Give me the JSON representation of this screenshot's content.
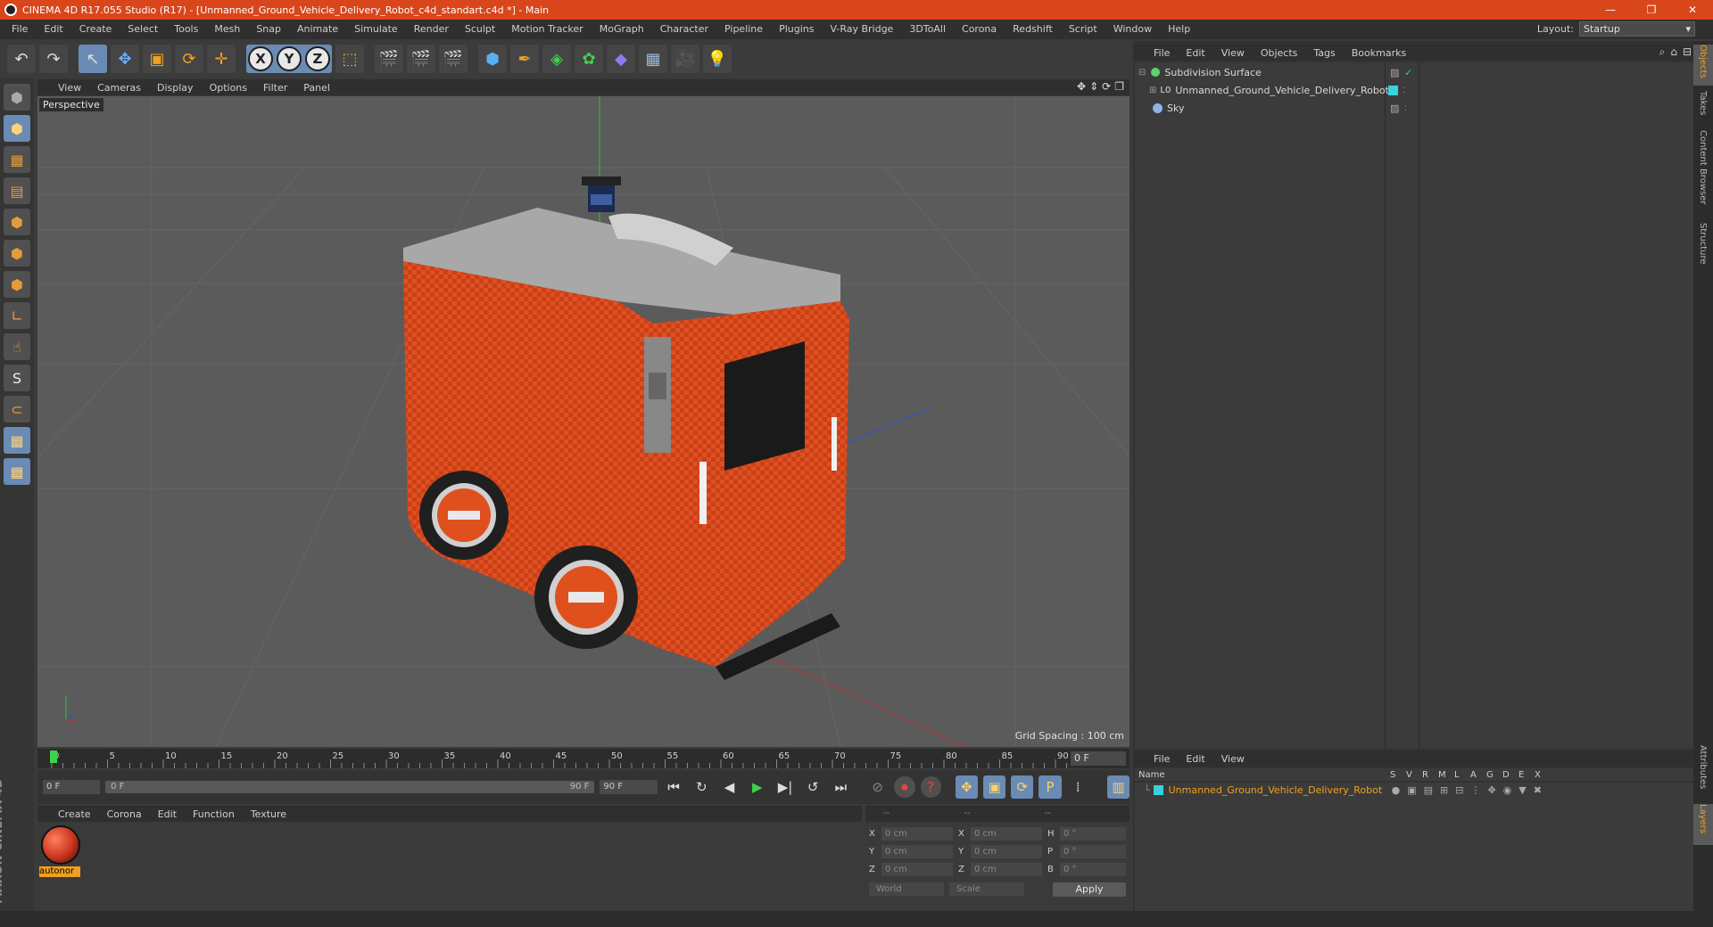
{
  "titlebar": {
    "title": "CINEMA 4D R17.055 Studio (R17) - [Unmanned_Ground_Vehicle_Delivery_Robot_c4d_standart.c4d *] - Main",
    "minimize": "—",
    "restore": "❐",
    "close": "✕"
  },
  "menu": [
    "File",
    "Edit",
    "Create",
    "Select",
    "Tools",
    "Mesh",
    "Snap",
    "Animate",
    "Simulate",
    "Render",
    "Sculpt",
    "Motion Tracker",
    "MoGraph",
    "Character",
    "Pipeline",
    "Plugins",
    "V-Ray Bridge",
    "3DToAll",
    "Corona",
    "Redshift",
    "Script",
    "Window",
    "Help"
  ],
  "layout": {
    "label": "Layout:",
    "value": "Startup"
  },
  "toolbar": {
    "undo": "↶",
    "redo": "↷",
    "select": "↖",
    "move": "✥",
    "scale": "▣",
    "rotate": "⟳",
    "transform": "✛",
    "axis_x": "X",
    "axis_y": "Y",
    "axis_z": "Z",
    "coord": "⬚",
    "render_view": "🎬",
    "render_pic": "🎬",
    "render_settings": "🎬",
    "cube": "⬢",
    "pen": "✒",
    "subdiv": "◈",
    "array": "✿",
    "deformer": "◆",
    "floor": "▦",
    "camera": "🎥",
    "light": "💡"
  },
  "left_tools": [
    "⬢",
    "▦",
    "▤",
    "⬢",
    "⬢",
    "⬢",
    "∟",
    "☝",
    "S",
    "⊂",
    "▦",
    "▦"
  ],
  "viewport": {
    "menu": [
      "View",
      "Cameras",
      "Display",
      "Options",
      "Filter",
      "Panel"
    ],
    "label": "Perspective",
    "grid_spacing": "Grid Spacing : 100 cm",
    "nav_icons": [
      "✥",
      "⇕",
      "⟳",
      "❐"
    ]
  },
  "timeline": {
    "ticks": [
      "0",
      "5",
      "10",
      "15",
      "20",
      "25",
      "30",
      "35",
      "40",
      "45",
      "50",
      "55",
      "60",
      "65",
      "70",
      "75",
      "80",
      "85",
      "90"
    ],
    "current_frame": "0 F",
    "start": "0 F",
    "slider_left": "0 F",
    "slider_right": "90 F",
    "end": "90 F"
  },
  "transport": {
    "first": "⏮",
    "prev_key": "↻",
    "prev": "◀",
    "play": "▶",
    "next": "▶|",
    "next_key": "↺",
    "last": "⏭",
    "key_off": "⊘",
    "record": "⏺",
    "help": "?",
    "move_key": "✥",
    "scale_key": "▣",
    "rot_key": "⟳",
    "param_key": "P",
    "grid": "⁞",
    "timeline": "▥"
  },
  "materials": {
    "menu": [
      "Create",
      "Corona",
      "Edit",
      "Function",
      "Texture"
    ],
    "items": [
      {
        "name": "autonor"
      }
    ]
  },
  "coordinates": {
    "head": [
      "--",
      "--",
      "--"
    ],
    "rows": [
      {
        "a": "X",
        "av": "0 cm",
        "b": "X",
        "bv": "0 cm",
        "c": "H",
        "cv": "0 °"
      },
      {
        "a": "Y",
        "av": "0 cm",
        "b": "Y",
        "bv": "0 cm",
        "c": "P",
        "cv": "0 °"
      },
      {
        "a": "Z",
        "av": "0 cm",
        "b": "Z",
        "bv": "0 cm",
        "c": "B",
        "cv": "0 °"
      }
    ],
    "mode": "World",
    "scale": "Scale",
    "apply": "Apply"
  },
  "object_manager": {
    "menu": [
      "File",
      "Edit",
      "View",
      "Objects",
      "Tags",
      "Bookmarks"
    ],
    "objects": [
      {
        "name": "Subdivision Surface",
        "icon_color": "#5fd36e",
        "indent": 0
      },
      {
        "name": "Unmanned_Ground_Vehicle_Delivery_Robot",
        "icon_color": "#cfcfcf",
        "indent": 1,
        "tag": "#3ad1d9"
      },
      {
        "name": "Sky",
        "icon_color": "#8bb5e8",
        "indent": 0
      }
    ]
  },
  "side_tabs": [
    "Objects",
    "Takes",
    "Content Browser",
    "Structure",
    "Attributes",
    "Layers"
  ],
  "layer_manager": {
    "menu": [
      "File",
      "Edit",
      "View"
    ],
    "columns": [
      "Name",
      "S",
      "V",
      "R",
      "M",
      "L",
      "A",
      "G",
      "D",
      "E",
      "X"
    ],
    "layers": [
      {
        "name": "Unmanned_Ground_Vehicle_Delivery_Robot",
        "color": "#3ad1d9"
      }
    ]
  },
  "colors": {
    "accent": "#d9461b",
    "selected": "#6a8bb3",
    "layer_text": "#f0a020"
  }
}
